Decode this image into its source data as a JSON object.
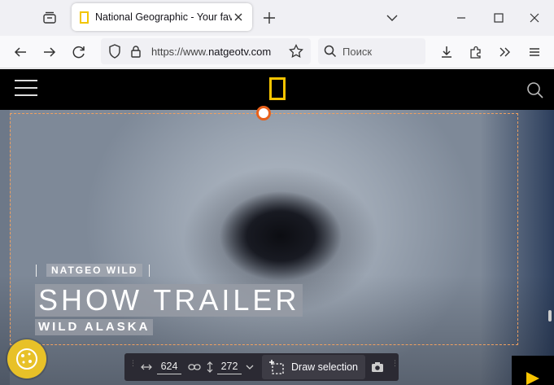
{
  "browser": {
    "tab": {
      "title": "National Geographic - Your fav"
    },
    "url": {
      "prefix": "https://www.",
      "host": "natgeotv.com"
    },
    "search_placeholder": "Поиск"
  },
  "hero": {
    "eyebrow": "NATGEO WILD",
    "title": "SHOW TRAILER",
    "subtitle": "WILD ALASKA"
  },
  "screenshot_toolbar": {
    "width_value": "624",
    "height_value": "272",
    "draw_label": "Draw selection"
  },
  "colors": {
    "logo_yellow": "#f8c400",
    "selection_accent": "#e8601a",
    "toolbar_bg": "#2b2a33"
  }
}
